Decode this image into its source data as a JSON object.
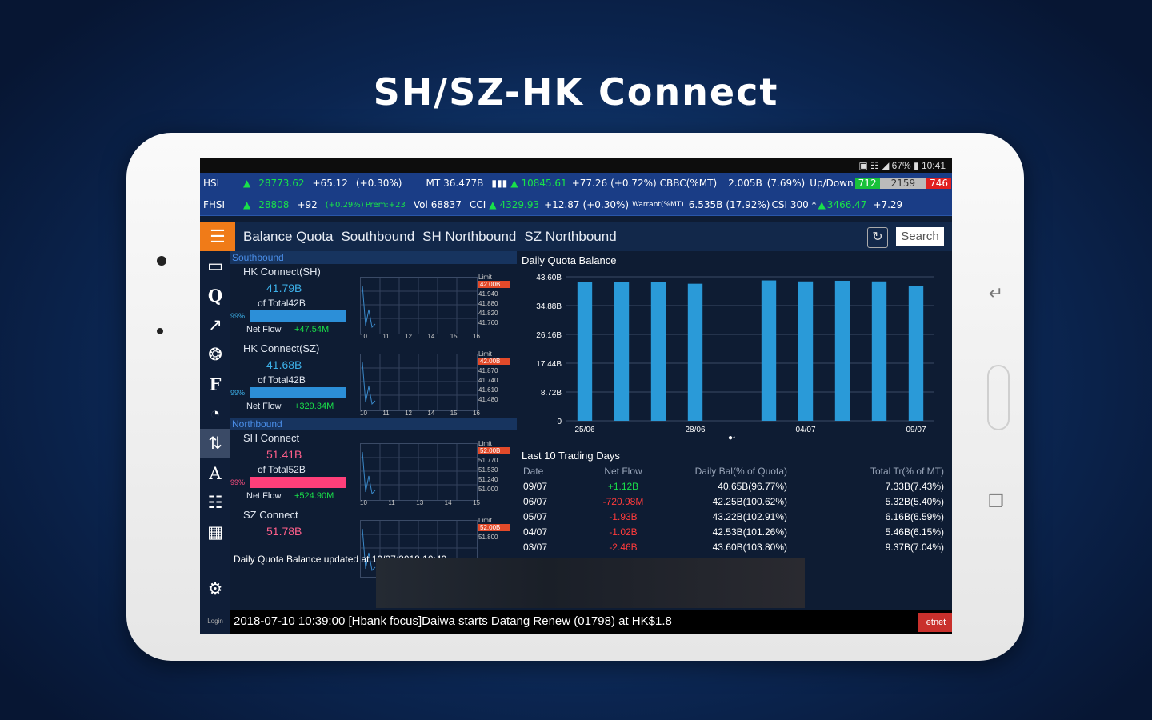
{
  "promo_title": "SH/SZ-HK Connect",
  "status": {
    "right": "▣ ☷ ◢ 67% ▮ 10:41"
  },
  "ticker1": {
    "label": "HSI",
    "price": "28773.62",
    "chg": "+65.12",
    "pct": "(+0.30%)",
    "mt_label": "MT",
    "mt": "36.477B",
    "idx2": "▮▮▮",
    "idx2_price": "10845.61",
    "idx2_chg": "+77.26",
    "idx2_pct": "(+0.72%)",
    "cbbc_label": "CBBC(%MT)",
    "cbbc": "2.005B",
    "cbbc_pct": "(7.69%)",
    "updown_label": "Up/Down",
    "up": "712",
    "flat": "2159",
    "down": "746"
  },
  "ticker2": {
    "label": "FHSI",
    "price": "28808",
    "chg": "+92",
    "pct": "(+0.29%)",
    "prem": "Prem:+23",
    "vol_label": "Vol",
    "vol": "68837",
    "cci_label": "CCI",
    "cci_price": "4329.93",
    "cci_chg": "+12.87",
    "cci_pct": "(+0.30%)",
    "warrant_label": "Warrant(%MT)",
    "warrant": "6.535B",
    "warrant_pct": "(17.92%)",
    "csi_label": "CSI 300 *",
    "csi_price": "3466.47",
    "csi_chg": "+7.29"
  },
  "tabs": [
    "Balance Quota",
    "Southbound",
    "SH Northbound",
    "SZ Northbound"
  ],
  "search_label": "Search",
  "southbound_label": "Southbound",
  "northbound_label": "Northbound",
  "connects": [
    {
      "title": "HK Connect(SH)",
      "value": "41.79B",
      "of": "of Total42B",
      "pct": "99%",
      "netflow_label": "Net Flow",
      "netflow": "+47.54M",
      "limits": [
        "42.00B",
        "41.940",
        "41.880",
        "41.820",
        "41.760"
      ],
      "xticks": [
        "10",
        "11",
        "12",
        "14",
        "15",
        "16"
      ]
    },
    {
      "title": "HK Connect(SZ)",
      "value": "41.68B",
      "of": "of Total42B",
      "pct": "99%",
      "netflow_label": "Net Flow",
      "netflow": "+329.34M",
      "limits": [
        "42.00B",
        "41.870",
        "41.740",
        "41.610",
        "41.480"
      ],
      "xticks": [
        "10",
        "11",
        "12",
        "14",
        "15",
        "16"
      ]
    },
    {
      "title": "SH Connect",
      "value": "51.41B",
      "of": "of Total52B",
      "pct": "99%",
      "netflow_label": "Net Flow",
      "netflow": "+524.90M",
      "limits": [
        "52.00B",
        "51.770",
        "51.530",
        "51.240",
        "51.000"
      ],
      "xticks": [
        "10",
        "11",
        "13",
        "14",
        "15"
      ]
    },
    {
      "title": "SZ Connect",
      "value": "51.78B",
      "of": "",
      "pct": "",
      "netflow_label": "",
      "netflow": "",
      "limits": [
        "52.00B",
        "51.800"
      ],
      "xticks": []
    }
  ],
  "limit_label": "Limit",
  "updated_text": "Daily Quota Balance updated at 10/07/2018 10:40",
  "chart_title": "Daily Quota Balance",
  "chart_data": {
    "type": "bar",
    "title": "Daily Quota Balance",
    "ylim": [
      0,
      43.6
    ],
    "yticks": [
      "43.60B",
      "34.88B",
      "26.16B",
      "17.44B",
      "8.72B",
      "0"
    ],
    "xticks": [
      "25/06",
      "28/06",
      "04/07",
      "09/07"
    ],
    "values": [
      42.1,
      42.1,
      42.0,
      41.5,
      0,
      42.5,
      42.2,
      42.4,
      42.2,
      40.7
    ],
    "colors": {
      "bar": "#2a9ad8"
    }
  },
  "last10_label": "Last 10 Trading Days",
  "table": {
    "headers": [
      "Date",
      "Net Flow",
      "Daily Bal(% of Quota)",
      "Total Tr(% of MT)"
    ],
    "rows": [
      {
        "date": "09/07",
        "flow": "+1.12B",
        "bal": "40.65B(96.77%)",
        "tr": "7.33B(7.43%)",
        "color": "#19e14a"
      },
      {
        "date": "06/07",
        "flow": "-720.98M",
        "bal": "42.25B(100.62%)",
        "tr": "5.32B(5.40%)",
        "color": "#ff3b3b"
      },
      {
        "date": "05/07",
        "flow": "-1.93B",
        "bal": "43.22B(102.91%)",
        "tr": "6.16B(6.59%)",
        "color": "#ff3b3b"
      },
      {
        "date": "04/07",
        "flow": "-1.02B",
        "bal": "42.53B(101.26%)",
        "tr": "5.46B(6.15%)",
        "color": "#ff3b3b"
      },
      {
        "date": "03/07",
        "flow": "-2.46B",
        "bal": "43.60B(103.80%)",
        "tr": "9.37B(7.04%)",
        "color": "#ff3b3b"
      }
    ]
  },
  "news": "2018-07-10 10:39:00  [Hbank focus]Daiwa starts Datang Renew (01798) at HK$1.8",
  "etnet": "etnet",
  "login": "Login",
  "menu_label": "Menu"
}
